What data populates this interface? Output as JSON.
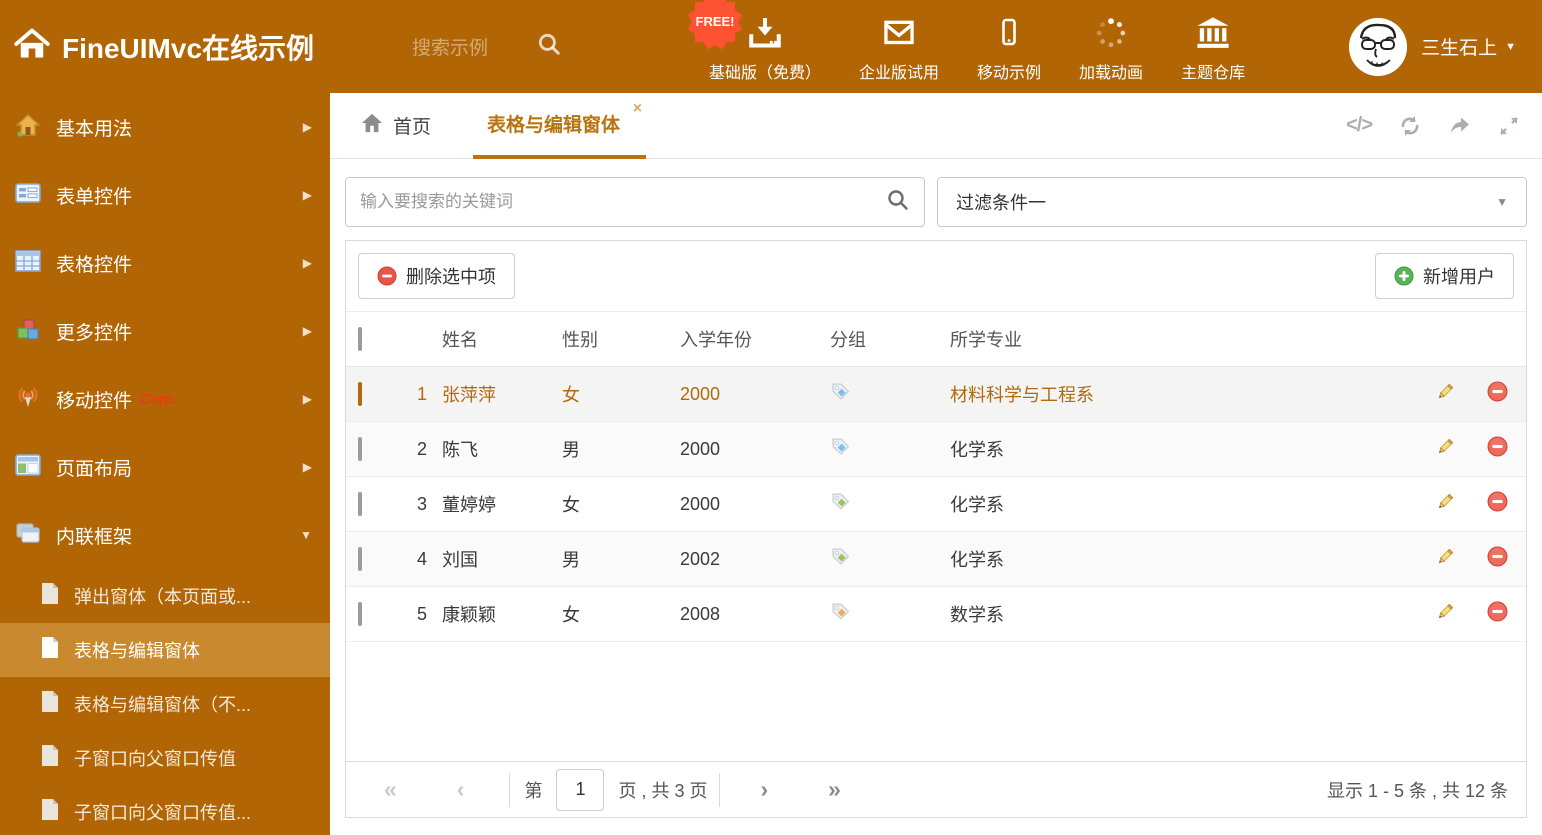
{
  "icons": {
    "arrow_right": "▶",
    "caret_down": "▼",
    "close": "×",
    "first": "«",
    "prev": "‹",
    "next": "›",
    "last": "»",
    "code": "</>"
  },
  "colors": {
    "header_bg": "#B16504",
    "sidebar_active_bg": "#C8892F",
    "accent": "#B8740F",
    "free_badge": "#FF5233",
    "delete_red": "#E8564A",
    "add_green": "#58B458",
    "tag_blue": "#7EC0EE",
    "tag_green": "#9CC65A",
    "tag_orange": "#F4A95C"
  },
  "header": {
    "title": "FineUIMvc在线示例",
    "search_placeholder": "搜索示例",
    "free_badge": "FREE!",
    "nav": [
      {
        "label": "基础版（免费）",
        "icon": "download-icon"
      },
      {
        "label": "企业版试用",
        "icon": "envelope-icon"
      },
      {
        "label": "移动示例",
        "icon": "mobile-icon"
      },
      {
        "label": "加载动画",
        "icon": "spinner-icon"
      },
      {
        "label": "主题仓库",
        "icon": "bank-icon"
      }
    ],
    "user": {
      "name": "三生石上"
    }
  },
  "sidebar": {
    "items": [
      {
        "label": "基本用法",
        "icon": "home-icon"
      },
      {
        "label": "表单控件",
        "icon": "form-icon"
      },
      {
        "label": "表格控件",
        "icon": "table-icon"
      },
      {
        "label": "更多控件",
        "icon": "cubes-icon"
      },
      {
        "label": "移动控件",
        "badge": "Corp.",
        "icon": "antenna-icon"
      },
      {
        "label": "页面布局",
        "icon": "layout-icon"
      },
      {
        "label": "内联框架",
        "icon": "frames-icon",
        "expanded": true
      }
    ],
    "subitems": [
      {
        "label": "弹出窗体（本页面或..."
      },
      {
        "label": "表格与编辑窗体",
        "active": true
      },
      {
        "label": "表格与编辑窗体（不..."
      },
      {
        "label": "子窗口向父窗口传值"
      },
      {
        "label": "子窗口向父窗口传值..."
      }
    ]
  },
  "tabs": {
    "home_label": "首页",
    "active_label": "表格与编辑窗体"
  },
  "filters": {
    "search_placeholder": "输入要搜索的关键词",
    "filter_value": "过滤条件一"
  },
  "grid": {
    "delete_button": "删除选中项",
    "add_button": "新增用户",
    "columns": [
      "姓名",
      "性别",
      "入学年份",
      "分组",
      "所学专业"
    ],
    "rows": [
      {
        "num": "1",
        "name": "张萍萍",
        "gender": "女",
        "year": "2000",
        "tag_color": "#7EC0EE",
        "major": "材料科学与工程系",
        "highlight": true
      },
      {
        "num": "2",
        "name": "陈飞",
        "gender": "男",
        "year": "2000",
        "tag_color": "#7EC0EE",
        "major": "化学系",
        "highlight": false
      },
      {
        "num": "3",
        "name": "董婷婷",
        "gender": "女",
        "year": "2000",
        "tag_color": "#9CC65A",
        "major": "化学系",
        "highlight": false
      },
      {
        "num": "4",
        "name": "刘国",
        "gender": "男",
        "year": "2002",
        "tag_color": "#9CC65A",
        "major": "化学系",
        "highlight": false
      },
      {
        "num": "5",
        "name": "康颖颖",
        "gender": "女",
        "year": "2008",
        "tag_color": "#F4A95C",
        "major": "数学系",
        "highlight": false
      }
    ]
  },
  "pagination": {
    "page_prefix": "第",
    "page_value": "1",
    "page_suffix": "页 , 共 3 页",
    "summary": "显示 1 - 5 条 , 共 12 条"
  }
}
